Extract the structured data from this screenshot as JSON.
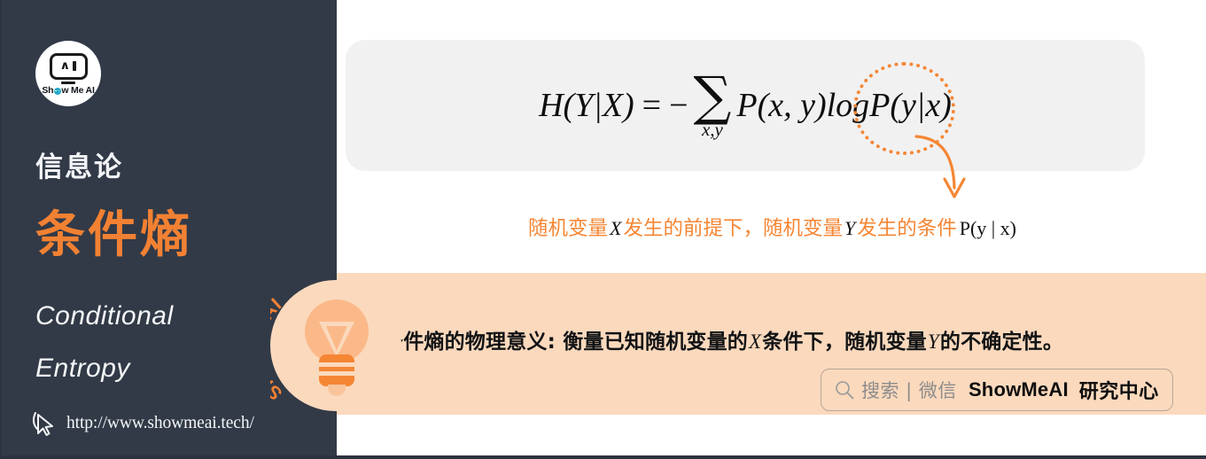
{
  "brand": {
    "logo_text_before": "Sh",
    "logo_text_after": "w Me AI",
    "logo_caret": "∧",
    "watermark": "ShowMeAI",
    "badge_curved_text": "ShowMeAI",
    "colors": {
      "sidebar_bg": "#323a47",
      "accent_orange": "#f28133",
      "banner_peach": "#fbd9bd",
      "formula_box_gray": "#f1f1f1",
      "cyan": "#27a8c8"
    }
  },
  "sidebar": {
    "subject": "信息论",
    "title": "条件熵",
    "english_line1": "Conditional",
    "english_line2": "Entropy",
    "url": "http://www.showmeai.tech/",
    "cursor_icon": "cursor-click-icon"
  },
  "formula": {
    "lhs": "H(Y|X)",
    "equals": "=",
    "minus": "−",
    "sum_symbol": "∑",
    "sum_subscript": "x,y",
    "term1": "P(x, y)",
    "log": "log",
    "highlighted_term": "P(y|x)",
    "full_latex": "H(Y|X) = -\\sum_{x,y} P(x,y) \\log P(y|x)",
    "annotation_circle": "dotted-ellipse-around-P(y|x)",
    "annotation_arrow": "curved-down-arrow"
  },
  "caption": {
    "part1": "随机变量",
    "var_x": "X",
    "part2": "发生的前提下，随机变量",
    "var_y": "Y",
    "part3": "发生的条件",
    "prob": "P(y | x)"
  },
  "banner": {
    "text_part1": "条件熵的物理意义: 衡量已知随机变量的",
    "var_x": "X",
    "text_part2": "条件下，随机变量",
    "var_y": "Y",
    "text_part3": "的不确定性。",
    "bulb_icon": "lightbulb-icon"
  },
  "search_pill": {
    "icon": "search-icon",
    "gray_text": "搜索 | 微信",
    "bold_text": "ShowMeAI",
    "bold_text2": "研究中心"
  }
}
